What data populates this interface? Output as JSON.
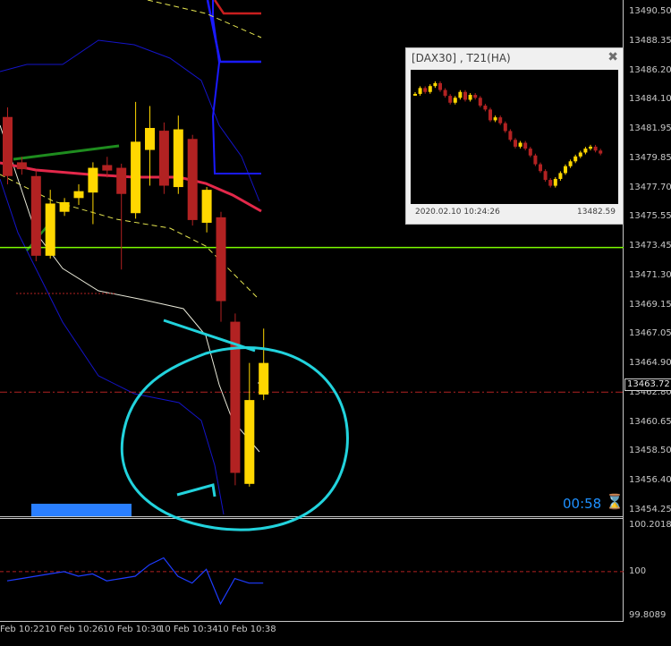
{
  "chart_data": {
    "type": "candlestick",
    "symbol": "DAX30",
    "timeframe": "T21(HA)",
    "price_axis": [
      "13490.50",
      "13488.35",
      "13486.20",
      "13484.10",
      "13481.95",
      "13479.85",
      "13477.70",
      "13475.55",
      "13473.45",
      "13471.30",
      "13469.15",
      "13467.05",
      "13464.90",
      "13462.80",
      "13460.65",
      "13458.50",
      "13456.40",
      "13454.25"
    ],
    "time_axis": [
      "Feb 10:22",
      "10 Feb 10:26",
      "10 Feb 10:30",
      "10 Feb 10:34",
      "10 Feb 10:38"
    ],
    "current_price": "13463.72",
    "horizontal_line_price": 13473.4,
    "candles": [
      {
        "open": 13482.9,
        "close": 13478.6,
        "high": 13483.6,
        "low": 13478.0
      },
      {
        "open": 13479.6,
        "close": 13479.1,
        "high": 13480.0,
        "low": 13478.7
      },
      {
        "open": 13478.6,
        "close": 13472.8,
        "high": 13479.0,
        "low": 13472.4
      },
      {
        "open": 13472.8,
        "close": 13476.6,
        "high": 13477.6,
        "low": 13472.6
      },
      {
        "open": 13476.0,
        "close": 13476.7,
        "high": 13477.0,
        "low": 13475.7
      },
      {
        "open": 13477.0,
        "close": 13477.5,
        "high": 13478.0,
        "low": 13476.5
      },
      {
        "open": 13477.4,
        "close": 13479.2,
        "high": 13479.6,
        "low": 13475.1
      },
      {
        "open": 13479.4,
        "close": 13479.0,
        "high": 13480.0,
        "low": 13478.5
      },
      {
        "open": 13479.2,
        "close": 13477.3,
        "high": 13479.5,
        "low": 13471.8
      },
      {
        "open": 13475.9,
        "close": 13481.1,
        "high": 13484.0,
        "low": 13475.5
      },
      {
        "open": 13480.5,
        "close": 13482.1,
        "high": 13483.7,
        "low": 13477.9
      },
      {
        "open": 13481.9,
        "close": 13477.9,
        "high": 13482.5,
        "low": 13477.3
      },
      {
        "open": 13477.8,
        "close": 13482.0,
        "high": 13483.0,
        "low": 13477.3
      },
      {
        "open": 13481.3,
        "close": 13475.4,
        "high": 13481.6,
        "low": 13475.0
      },
      {
        "open": 13475.2,
        "close": 13477.6,
        "high": 13477.8,
        "low": 13474.5
      },
      {
        "open": 13475.6,
        "close": 13469.5,
        "high": 13476.0,
        "low": 13468.0
      },
      {
        "open": 13468.0,
        "close": 13457.0,
        "high": 13468.6,
        "low": 13456.1
      },
      {
        "open": 13456.2,
        "close": 13462.3,
        "high": 13465.0,
        "low": 13456.0
      },
      {
        "open": 13462.7,
        "close": 13465.0,
        "high": 13467.5,
        "low": 13462.3
      }
    ],
    "indicator_axis": [
      "100.2018",
      "100",
      "99.8089"
    ],
    "indicator_values": [
      99.96,
      99.97,
      99.98,
      99.99,
      100.0,
      99.98,
      99.99,
      99.96,
      99.97,
      99.98,
      100.03,
      100.06,
      99.98,
      99.95,
      100.01,
      99.86,
      99.97,
      99.95,
      99.95
    ]
  },
  "mini_window": {
    "title": "[DAX30] , T21(HA)",
    "date": "2020.02.10 10:24:26",
    "price": "13482.59"
  },
  "timer": "00:58",
  "colors": {
    "bull": "#ffd700",
    "bear": "#b22222",
    "ma_red": "#e3284a",
    "band_blue": "#1414c8",
    "green_line": "#7cfc00",
    "annotation": "#22d3dd"
  }
}
